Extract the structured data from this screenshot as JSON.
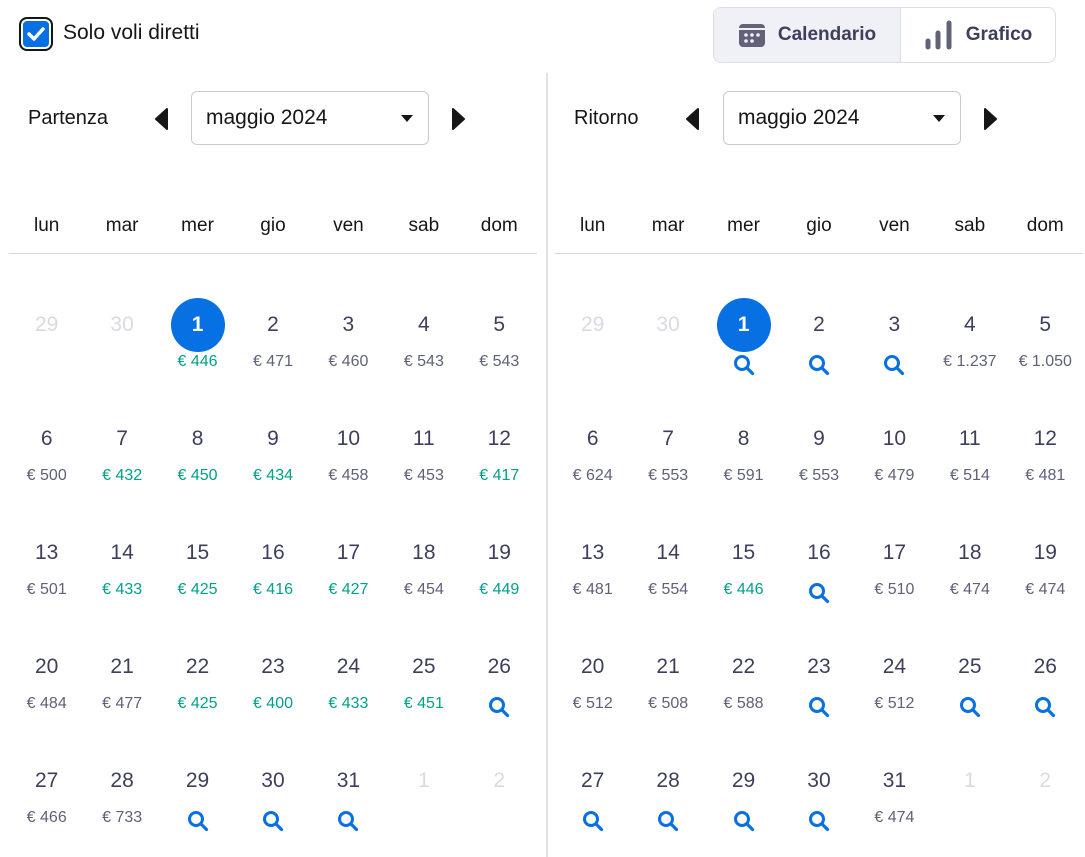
{
  "filter": {
    "direct_only_label": "Solo voli diretti",
    "direct_only_checked": true
  },
  "view_toggle": {
    "calendar_label": "Calendario",
    "chart_label": "Grafico",
    "active": "calendar"
  },
  "colors": {
    "accent": "#0770e3",
    "cheap": "#00a08a",
    "price": "#5f6178",
    "muted": "#d9dae3"
  },
  "weekdays": [
    "lun",
    "mar",
    "mer",
    "gio",
    "ven",
    "sab",
    "dom"
  ],
  "departure": {
    "label": "Partenza",
    "month": "maggio 2024",
    "cells": [
      {
        "day": "29",
        "muted": true
      },
      {
        "day": "30",
        "muted": true
      },
      {
        "day": "1",
        "price": "€ 446",
        "cheap": true,
        "selected": true
      },
      {
        "day": "2",
        "price": "€ 471"
      },
      {
        "day": "3",
        "price": "€ 460"
      },
      {
        "day": "4",
        "price": "€ 543"
      },
      {
        "day": "5",
        "price": "€ 543"
      },
      {
        "day": "6",
        "price": "€ 500"
      },
      {
        "day": "7",
        "price": "€ 432",
        "cheap": true
      },
      {
        "day": "8",
        "price": "€ 450",
        "cheap": true
      },
      {
        "day": "9",
        "price": "€ 434",
        "cheap": true
      },
      {
        "day": "10",
        "price": "€ 458"
      },
      {
        "day": "11",
        "price": "€ 453"
      },
      {
        "day": "12",
        "price": "€ 417",
        "cheap": true
      },
      {
        "day": "13",
        "price": "€ 501"
      },
      {
        "day": "14",
        "price": "€ 433",
        "cheap": true
      },
      {
        "day": "15",
        "price": "€ 425",
        "cheap": true
      },
      {
        "day": "16",
        "price": "€ 416",
        "cheap": true
      },
      {
        "day": "17",
        "price": "€ 427",
        "cheap": true
      },
      {
        "day": "18",
        "price": "€ 454"
      },
      {
        "day": "19",
        "price": "€ 449",
        "cheap": true
      },
      {
        "day": "20",
        "price": "€ 484"
      },
      {
        "day": "21",
        "price": "€ 477"
      },
      {
        "day": "22",
        "price": "€ 425",
        "cheap": true
      },
      {
        "day": "23",
        "price": "€ 400",
        "cheap": true
      },
      {
        "day": "24",
        "price": "€ 433",
        "cheap": true
      },
      {
        "day": "25",
        "price": "€ 451",
        "cheap": true
      },
      {
        "day": "26",
        "search": true
      },
      {
        "day": "27",
        "price": "€ 466"
      },
      {
        "day": "28",
        "price": "€ 733"
      },
      {
        "day": "29",
        "search": true
      },
      {
        "day": "30",
        "search": true
      },
      {
        "day": "31",
        "search": true
      },
      {
        "day": "1",
        "muted": true
      },
      {
        "day": "2",
        "muted": true
      }
    ]
  },
  "return": {
    "label": "Ritorno",
    "month": "maggio 2024",
    "cells": [
      {
        "day": "29",
        "muted": true
      },
      {
        "day": "30",
        "muted": true
      },
      {
        "day": "1",
        "search": true,
        "selected": true
      },
      {
        "day": "2",
        "search": true
      },
      {
        "day": "3",
        "search": true
      },
      {
        "day": "4",
        "price": "€ 1.237"
      },
      {
        "day": "5",
        "price": "€ 1.050"
      },
      {
        "day": "6",
        "price": "€ 624"
      },
      {
        "day": "7",
        "price": "€ 553"
      },
      {
        "day": "8",
        "price": "€ 591"
      },
      {
        "day": "9",
        "price": "€ 553"
      },
      {
        "day": "10",
        "price": "€ 479"
      },
      {
        "day": "11",
        "price": "€ 514"
      },
      {
        "day": "12",
        "price": "€ 481"
      },
      {
        "day": "13",
        "price": "€ 481"
      },
      {
        "day": "14",
        "price": "€ 554"
      },
      {
        "day": "15",
        "price": "€ 446",
        "cheap": true
      },
      {
        "day": "16",
        "search": true
      },
      {
        "day": "17",
        "price": "€ 510"
      },
      {
        "day": "18",
        "price": "€ 474"
      },
      {
        "day": "19",
        "price": "€ 474"
      },
      {
        "day": "20",
        "price": "€ 512"
      },
      {
        "day": "21",
        "price": "€ 508"
      },
      {
        "day": "22",
        "price": "€ 588"
      },
      {
        "day": "23",
        "search": true
      },
      {
        "day": "24",
        "price": "€ 512"
      },
      {
        "day": "25",
        "search": true
      },
      {
        "day": "26",
        "search": true
      },
      {
        "day": "27",
        "search": true
      },
      {
        "day": "28",
        "search": true
      },
      {
        "day": "29",
        "search": true
      },
      {
        "day": "30",
        "search": true
      },
      {
        "day": "31",
        "price": "€ 474"
      },
      {
        "day": "1",
        "muted": true
      },
      {
        "day": "2",
        "muted": true
      }
    ]
  }
}
